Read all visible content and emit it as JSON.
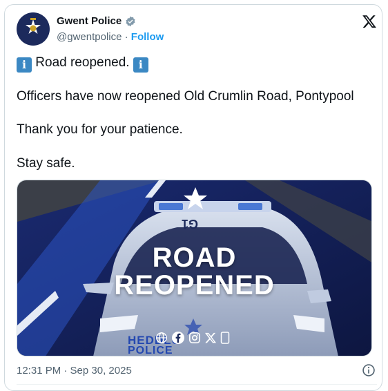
{
  "post": {
    "author_name": "Gwent Police",
    "handle": "@gwentpolice",
    "separator": "·",
    "follow_label": "Follow",
    "line1": "Road reopened.",
    "line2": "Officers have now reopened Old Crumlin Road, Pontypool",
    "line3": "Thank you for your patience.",
    "line4": "Stay safe.",
    "timestamp": "12:31 PM · Sep 30, 2025"
  },
  "media": {
    "title_line1": "ROAD",
    "title_line2": "REOPENED",
    "car_text1": "HEDDLU",
    "car_text2": "POLICE",
    "car_number": "G1"
  },
  "icons": {
    "verified": "verified-badge-icon",
    "x_logo": "x-logo-icon",
    "info_emoji": "information-emoji-icon",
    "info": "info-icon"
  },
  "colors": {
    "accent": "#1d9bf0",
    "text": "#0f1419",
    "muted": "#536471",
    "border": "#cfd9de"
  }
}
